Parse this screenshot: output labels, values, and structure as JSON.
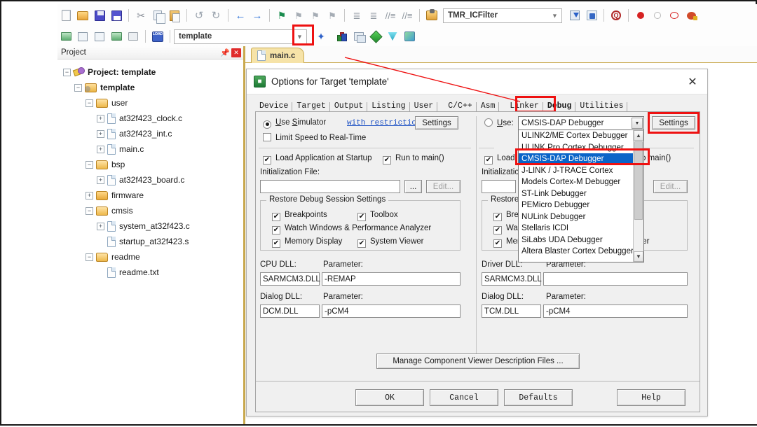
{
  "toolbar": {
    "row1_icons": [
      "new-file-icon",
      "open-folder-icon",
      "save-icon",
      "save-all-icon",
      "cut-icon",
      "copy-icon",
      "paste-icon",
      "undo-icon",
      "redo-icon",
      "back-icon",
      "forward-icon",
      "bookmark-icon",
      "bookmark-next-icon",
      "bookmark-prev-icon",
      "bookmark-clear-icon",
      "indent-icon",
      "outdent-icon",
      "comment-icon",
      "uncomment-icon"
    ],
    "row2_icons": [
      "build-icon",
      "build-target-icon",
      "rebuild-icon",
      "batch-build-icon",
      "stop-build-icon",
      "download-icon"
    ],
    "target_combo_value": "template",
    "function_combo_value": "TMR_ICFilter",
    "magic_wand_name": "magic-wand-icon",
    "manage_project_icon": "manage-project-items-icon",
    "multi_project_icon": "multi-project-icon",
    "debug_icon": "start-debug-icon",
    "bp_insert_icon": "insert-breakpoint-icon",
    "bp_disable_icon": "disable-breakpoint-icon",
    "bp_kill_icon": "kill-all-breakpoints-icon",
    "bp_manage_icon": "breakpoint-manager-icon"
  },
  "project_panel": {
    "title": "Project",
    "pin_icon": "pin-icon",
    "close_icon": "close-icon",
    "tree": [
      {
        "label": "Project: template",
        "type": "project",
        "indent": 0,
        "expander": "minus"
      },
      {
        "label": "template",
        "type": "target",
        "indent": 1,
        "expander": "minus"
      },
      {
        "label": "user",
        "type": "folder",
        "indent": 2,
        "expander": "minus"
      },
      {
        "label": "at32f423_clock.c",
        "type": "file",
        "indent": 3,
        "expander": "plus"
      },
      {
        "label": "at32f423_int.c",
        "type": "file",
        "indent": 3,
        "expander": "plus"
      },
      {
        "label": "main.c",
        "type": "file",
        "indent": 3,
        "expander": "plus"
      },
      {
        "label": "bsp",
        "type": "folder",
        "indent": 2,
        "expander": "minus"
      },
      {
        "label": "at32f423_board.c",
        "type": "file",
        "indent": 3,
        "expander": "plus"
      },
      {
        "label": "firmware",
        "type": "folder-closed",
        "indent": 2,
        "expander": "plus"
      },
      {
        "label": "cmsis",
        "type": "folder",
        "indent": 2,
        "expander": "minus"
      },
      {
        "label": "system_at32f423.c",
        "type": "file",
        "indent": 3,
        "expander": "plus"
      },
      {
        "label": "startup_at32f423.s",
        "type": "file",
        "indent": 3,
        "expander": "none"
      },
      {
        "label": "readme",
        "type": "folder",
        "indent": 2,
        "expander": "minus"
      },
      {
        "label": "readme.txt",
        "type": "file",
        "indent": 3,
        "expander": "none"
      }
    ]
  },
  "editor": {
    "tab_label": "main.c",
    "tab_icon": "c-file-icon"
  },
  "dialog": {
    "title": "Options for Target 'template'",
    "icon": "keil-options-icon",
    "close_label": "✕",
    "tabs": [
      {
        "label": "Device",
        "active": false
      },
      {
        "label": "Target",
        "active": false
      },
      {
        "label": "Output",
        "active": false
      },
      {
        "label": "Listing",
        "active": false
      },
      {
        "label": "User",
        "active": false
      },
      {
        "label": "C/C++",
        "active": false
      },
      {
        "label": "Asm",
        "active": false
      },
      {
        "label": "Linker",
        "active": false
      },
      {
        "label": "Debug",
        "active": true
      },
      {
        "label": "Utilities",
        "active": false
      }
    ],
    "left": {
      "use_simulator_label": "Use Simulator",
      "use_simulator_checked": true,
      "with_restrictions_link": "with restrictions",
      "settings_button": "Settings",
      "limit_speed_label": "Limit Speed to Real-Time",
      "limit_speed_checked": false,
      "load_app_label": "Load Application at Startup",
      "load_app_checked": true,
      "run_to_main_label": "Run to main()",
      "run_to_main_checked": true,
      "init_file_label": "Initialization File:",
      "init_file_value": "",
      "browse_button": "...",
      "edit_button": "Edit...",
      "restore_group_label": "Restore Debug Session Settings",
      "restore_items": [
        {
          "label": "Breakpoints",
          "checked": true
        },
        {
          "label": "Toolbox",
          "checked": true
        },
        {
          "label": "Watch Windows & Performance Analyzer",
          "checked": true
        },
        {
          "label": "Memory Display",
          "checked": true
        },
        {
          "label": "System Viewer",
          "checked": true
        }
      ],
      "cpu_dll_label": "CPU DLL:",
      "cpu_dll_value": "SARMCM3.DLL",
      "cpu_param_label": "Parameter:",
      "cpu_param_value": "-REMAP",
      "dialog_dll_label": "Dialog DLL:",
      "dialog_dll_value": "DCM.DLL",
      "dialog_param_label": "Parameter:",
      "dialog_param_value": "-pCM4"
    },
    "right": {
      "use_label": "Use:",
      "use_checked": false,
      "selected_debugger": "CMSIS-DAP Debugger",
      "settings_button": "Settings",
      "load_app_label": "Load",
      "run_to_main_label": "o main()",
      "init_file_label": "Initializatio",
      "edit_button": "Edit...",
      "restore_group_label": "Restore",
      "restore_items": [
        {
          "label": "Bre",
          "checked": true
        },
        {
          "label": "Watch Windows",
          "checked": true
        },
        {
          "label": "Memory Display",
          "checked": true
        },
        {
          "label": "System Viewer",
          "checked": true
        }
      ],
      "driver_dll_label": "Driver DLL:",
      "driver_dll_value": "SARMCM3.DLL",
      "driver_param_label": "Parameter:",
      "driver_param_value": "",
      "dialog_dll_label": "Dialog DLL:",
      "dialog_dll_value": "TCM.DLL",
      "dialog_param_label": "Parameter:",
      "dialog_param_value": "-pCM4"
    },
    "dropdown": {
      "items": [
        {
          "label": "ULINK2/ME Cortex Debugger",
          "selected": false
        },
        {
          "label": "ULINK Pro Cortex Debugger",
          "selected": false
        },
        {
          "label": "CMSIS-DAP Debugger",
          "selected": true
        },
        {
          "label": "J-LINK / J-TRACE Cortex",
          "selected": false
        },
        {
          "label": "Models Cortex-M Debugger",
          "selected": false
        },
        {
          "label": "ST-Link Debugger",
          "selected": false
        },
        {
          "label": "PEMicro Debugger",
          "selected": false
        },
        {
          "label": "NULink Debugger",
          "selected": false
        },
        {
          "label": "Stellaris ICDI",
          "selected": false
        },
        {
          "label": "SiLabs UDA Debugger",
          "selected": false
        },
        {
          "label": "Altera Blaster Cortex Debugger",
          "selected": false
        }
      ],
      "scroll_up_icon": "chevron-up-icon",
      "scroll_down_icon": "chevron-down-icon"
    },
    "manage_cv_button": "Manage Component Viewer Description Files ...",
    "bottom_buttons": [
      "OK",
      "Cancel",
      "Defaults",
      "Help"
    ]
  },
  "annotations": {
    "highlight_color": "#ee1111",
    "boxes": [
      "magic-wand-toolbar-box",
      "debug-tab-box",
      "settings-button-box",
      "cmsis-dap-item-box"
    ],
    "arrow": "magic-wand-to-debug-tab-line"
  }
}
